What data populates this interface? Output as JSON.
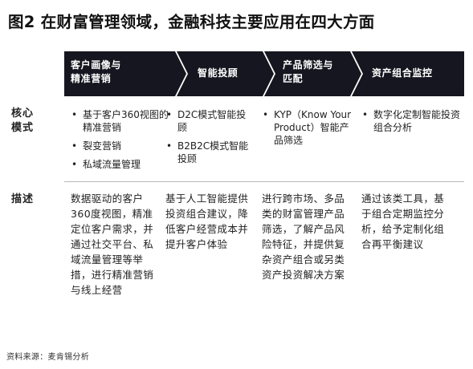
{
  "title": "图2 在财富管理领域，金融科技主要应用在四大方面",
  "colors": {
    "chevron_fill": "#15161f",
    "text": "#222222",
    "divider": "#b8b8b8"
  },
  "columns": [
    {
      "header": "客户画像与\n精准营销"
    },
    {
      "header": "智能投顾"
    },
    {
      "header": "产品筛选与\n匹配"
    },
    {
      "header": "资产组合监控"
    }
  ],
  "rows": {
    "core_label": "核心\n模式",
    "desc_label": "描述"
  },
  "core_modes": [
    [
      "基于客户360视图的精准营销",
      "裂变营销",
      "私域流量管理"
    ],
    [
      "D2C模式智能投顾",
      "B2B2C模式智能投顾"
    ],
    [
      "KYP（Know Your Product）智能产品筛选"
    ],
    [
      "数字化定制智能投资组合分析"
    ]
  ],
  "descriptions": [
    "数据驱动的客户360度视图，精准定位客户需求，并通过社交平台、私域流量管理等举措，进行精准营销与线上经营",
    "基于人工智能提供投资组合建议，降低客户经营成本并提升客户体验",
    "进行跨市场、多品类的财富管理产品筛选，了解产品风险特征，并提供复杂资产组合或另类资产投资解决方案",
    "通过该类工具，基于组合定期监控分析，给予定制化组合再平衡建议"
  ],
  "source": "资料来源：麦肯锡分析"
}
